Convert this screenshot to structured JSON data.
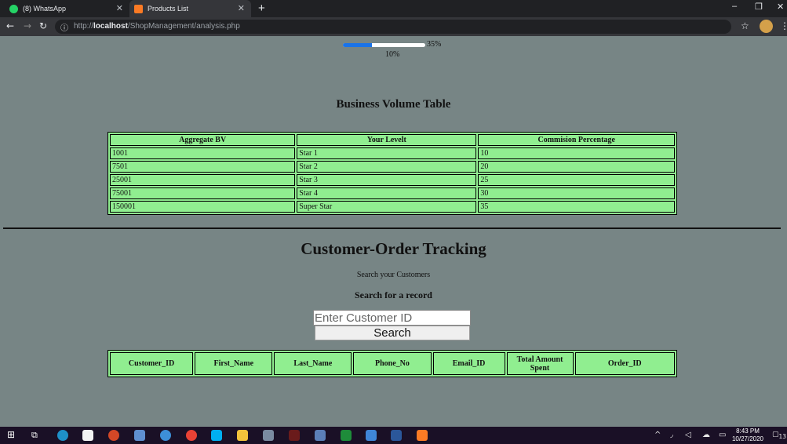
{
  "browser": {
    "tabs": [
      {
        "title": "(8) WhatsApp",
        "icon": "whatsapp-icon"
      },
      {
        "title": "Products List",
        "icon": "xampp-icon"
      }
    ],
    "url_prefix": "http://",
    "url_host": "localhost",
    "url_path": "/ShopManagement/analysis.php"
  },
  "progress": {
    "value": 0.35,
    "label_right": "35%",
    "label_below": "10%"
  },
  "bv": {
    "title": "Business Volume Table",
    "headers": [
      "Aggregate BV",
      "Your Levelt",
      "Commision Percentage"
    ],
    "rows": [
      [
        "1001",
        "Star 1",
        "10"
      ],
      [
        "7501",
        "Star 2",
        "20"
      ],
      [
        "25001",
        "Star 3",
        "25"
      ],
      [
        "75001",
        "Star 4",
        "30"
      ],
      [
        "150001",
        "Super Star",
        "35"
      ]
    ]
  },
  "tracking": {
    "title": "Customer-Order Tracking",
    "subtitle": "Search your Customers",
    "search_heading": "Search for a record",
    "input_placeholder": "Enter Customer ID",
    "button_label": "Search",
    "headers": [
      "Customer_ID",
      "First_Name",
      "Last_Name",
      "Phone_No",
      "Email_ID",
      "Total Amount Spent",
      "Order_ID"
    ]
  },
  "taskbar": {
    "time": "8:43 PM",
    "date": "10/27/2020",
    "notification_count": "13"
  },
  "colors": {
    "page_bg": "#778585",
    "table_green": "#90ee90",
    "progress_blue": "#1a73e8"
  }
}
